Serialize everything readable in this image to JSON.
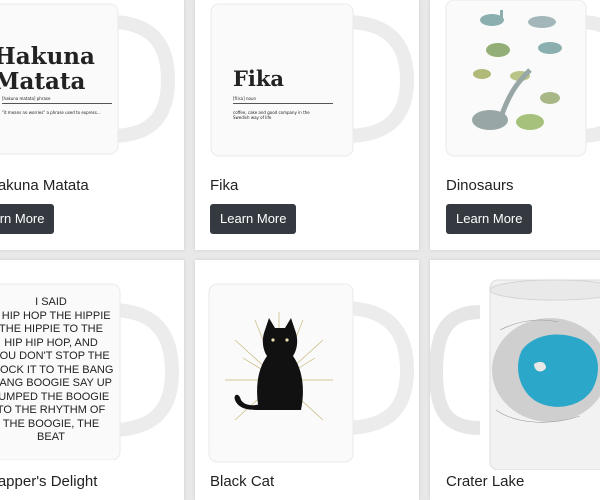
{
  "products": [
    {
      "title": "Hakuna Matata",
      "button": "Learn More",
      "mug_heading": "Hakuna\nMatata",
      "mug_subtitle": "[hakuna matata] phrase",
      "mug_definition": "\"it means no worries\" a phrase used to express..."
    },
    {
      "title": "Fika",
      "button": "Learn More",
      "mug_heading": "Fika",
      "mug_subtitle": "[fi:ka] noun",
      "mug_definition": "coffee, cake and good company in the Swedish way of life"
    },
    {
      "title": "Dinosaurs",
      "button": "Learn More"
    },
    {
      "title": "Rapper's Delight",
      "button": "Learn More",
      "mug_lyrics": "I SAID\nA HIP HOP THE HIPPIE\nTHE HIPPIE TO THE\nHIP HIP HOP, AND\nYOU DON'T STOP THE\nROCK IT TO THE BANG\nBANG BOOGIE SAY UP\nJUMPED THE BOOGIE\nTO THE RHYTHM OF\nTHE BOOGIE, THE\nBEAT"
    },
    {
      "title": "Black Cat",
      "button": "Learn More"
    },
    {
      "title": "Crater Lake",
      "button": "Learn More"
    }
  ],
  "colors": {
    "button_bg": "#343a40",
    "page_bg": "#e8e8e8",
    "lake_blue": "#2aa7c9"
  }
}
